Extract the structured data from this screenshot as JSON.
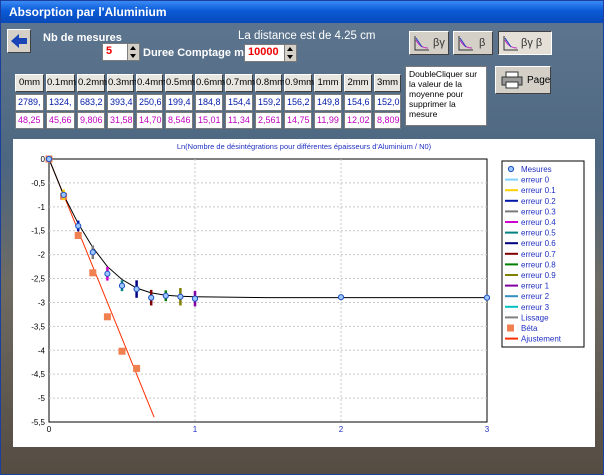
{
  "window": {
    "title": "Absorption par l'Aluminium"
  },
  "controls": {
    "nb_label": "Nb de mesures",
    "nb_value": "5",
    "duree_label": "Duree Comptage ms",
    "duree_value": "10000",
    "distance_text": "La distance est de 4.25 cm"
  },
  "toolbar": {
    "btn_by": "βγ",
    "btn_b": "β",
    "btn_byb": "βγ β",
    "page_label": "Page"
  },
  "info_text": "DoubleCliquer sur la valeur de la moyenne pour supprimer la mesure",
  "table": {
    "columns": [
      "0mm",
      "0.1mm",
      "0.2mm",
      "0.3mm",
      "0.4mm",
      "0.5mm",
      "0.6mm",
      "0.7mm",
      "0.8mm",
      "0.9mm",
      "1mm",
      "2mm",
      "3mm"
    ],
    "mesures": [
      "2789,",
      "1324,",
      "683,2",
      "393,4",
      "250,6",
      "199,4",
      "184,8",
      "154,4",
      "159,2",
      "156,2",
      "149,8",
      "154,6",
      "152,0"
    ],
    "erreurs": [
      "48,25",
      "45,66",
      "9,806",
      "31,58",
      "14,70",
      "8,546",
      "15,01",
      "11,34",
      "2,561",
      "14,75",
      "11,99",
      "12,02",
      "8,809"
    ]
  },
  "chart_data": {
    "type": "scatter",
    "title": "Ln(Nombre  de désintégrations pour différentes épaisseurs d'Aluminium / N0)",
    "xlim": [
      0,
      3
    ],
    "ylim": [
      -5.5,
      0
    ],
    "x_ticks": [
      "0",
      "1",
      "2",
      "3"
    ],
    "y_ticks": [
      "0",
      "-0,5",
      "-1",
      "-1,5",
      "-2",
      "-2,5",
      "-3",
      "-3,5",
      "-4",
      "-4,5",
      "-5",
      "-5,5"
    ],
    "grid": true,
    "legend_position": "right",
    "series": [
      {
        "name": "Mesures",
        "x": [
          0,
          0.1,
          0.2,
          0.3,
          0.4,
          0.5,
          0.6,
          0.7,
          0.8,
          0.9,
          1,
          2,
          3
        ],
        "y": [
          0,
          -0.75,
          -1.4,
          -1.95,
          -2.4,
          -2.65,
          -2.72,
          -2.9,
          -2.86,
          -2.88,
          -2.92,
          -2.89,
          -2.9
        ]
      },
      {
        "name": "Béta",
        "x": [
          0,
          0.1,
          0.2,
          0.3,
          0.4,
          0.5,
          0.6
        ],
        "y": [
          0,
          -0.78,
          -1.6,
          -2.38,
          -3.3,
          -4.02,
          -4.38
        ]
      },
      {
        "name": "Lissage",
        "x": [
          0,
          0.1,
          0.2,
          0.3,
          0.4,
          0.5,
          0.6,
          0.7,
          0.8,
          0.9,
          1,
          1.5,
          2,
          2.5,
          3
        ],
        "y": [
          0,
          -0.75,
          -1.35,
          -1.85,
          -2.25,
          -2.52,
          -2.7,
          -2.8,
          -2.85,
          -2.87,
          -2.88,
          -2.9,
          -2.9,
          -2.9,
          -2.9
        ]
      },
      {
        "name": "Ajustement",
        "x": [
          0,
          0.72
        ],
        "y": [
          0,
          -5.4
        ]
      }
    ],
    "error_bars": [
      {
        "x": 0.1,
        "y": -0.75,
        "err": 0.05,
        "color": "#ffd000"
      },
      {
        "x": 0.2,
        "y": -1.4,
        "err": 0.05,
        "color": "#0018a8"
      },
      {
        "x": 0.3,
        "y": -1.95,
        "err": 0.08,
        "color": "#7a7a7a"
      },
      {
        "x": 0.4,
        "y": -2.4,
        "err": 0.08,
        "color": "#d000d0"
      },
      {
        "x": 0.5,
        "y": -2.65,
        "err": 0.05,
        "color": "#008080"
      },
      {
        "x": 0.6,
        "y": -2.72,
        "err": 0.12,
        "color": "#000080"
      },
      {
        "x": 0.7,
        "y": -2.9,
        "err": 0.1,
        "color": "#800000"
      },
      {
        "x": 0.8,
        "y": -2.86,
        "err": 0.05,
        "color": "#008000"
      },
      {
        "x": 0.9,
        "y": -2.88,
        "err": 0.12,
        "color": "#808000"
      },
      {
        "x": 1,
        "y": -2.92,
        "err": 0.1,
        "color": "#8000a0"
      }
    ],
    "legend": [
      {
        "label": "Mesures",
        "kind": "marker",
        "color": "#3a6fd8"
      },
      {
        "label": "erreur 0",
        "kind": "line",
        "color": "#7fd0ff"
      },
      {
        "label": "erreur 0.1",
        "kind": "line",
        "color": "#ffd000"
      },
      {
        "label": "erreur 0.2",
        "kind": "line",
        "color": "#0018a8"
      },
      {
        "label": "erreur 0.3",
        "kind": "line",
        "color": "#7a7a7a"
      },
      {
        "label": "erreur 0.4",
        "kind": "line",
        "color": "#d000d0"
      },
      {
        "label": "erreur 0.5",
        "kind": "line",
        "color": "#008080"
      },
      {
        "label": "erreur 0.6",
        "kind": "line",
        "color": "#000080"
      },
      {
        "label": "erreur 0.7",
        "kind": "line",
        "color": "#800000"
      },
      {
        "label": "erreur 0.8",
        "kind": "line",
        "color": "#008000"
      },
      {
        "label": "erreur 0.9",
        "kind": "line",
        "color": "#808000"
      },
      {
        "label": "erreur 1",
        "kind": "line",
        "color": "#8000a0"
      },
      {
        "label": "erreur 2",
        "kind": "line",
        "color": "#3090c0"
      },
      {
        "label": "erreur 3",
        "kind": "line",
        "color": "#00c0c0"
      },
      {
        "label": "Lissage",
        "kind": "line",
        "color": "#808080"
      },
      {
        "label": "Béta",
        "kind": "square",
        "color": "#f08050"
      },
      {
        "label": "Ajustement",
        "kind": "line",
        "color": "#ff3000"
      }
    ]
  }
}
